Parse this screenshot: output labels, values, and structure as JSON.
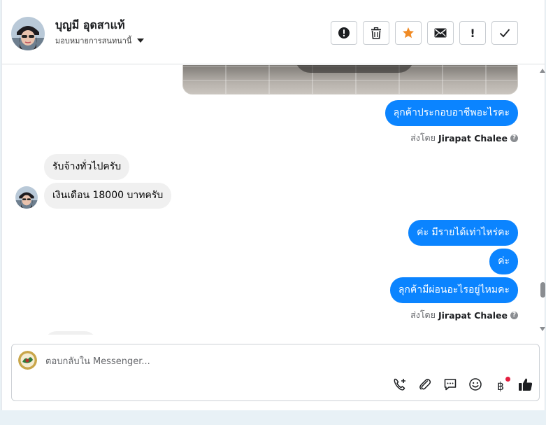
{
  "header": {
    "contact_name": "บุญมี อุดสาแท้",
    "assign_label": "มอบหมายการสนทนานี้"
  },
  "toolbar": {
    "buttons": [
      {
        "icon": "alert-circle-icon"
      },
      {
        "icon": "trash-icon"
      },
      {
        "icon": "star-icon",
        "color": "#f08a24"
      },
      {
        "icon": "envelope-icon"
      },
      {
        "icon": "exclamation-icon",
        "label": "!"
      },
      {
        "icon": "checkmark-icon"
      }
    ]
  },
  "messages": {
    "out1": "ลุกค้าประกอบอาชีพอะไรคะ",
    "sent_by_1": {
      "prefix": "ส่งโดย",
      "name": "Jirapat Chalee"
    },
    "in1": "รับจ้างทั่วไปครับ",
    "in2": "เงินเดือน 18000 บาทครับ",
    "out2": "ค่ะ มีรายได้เท่าไหร่คะ",
    "out3": "ค่ะ",
    "out4": "ลุกค้ามีผ่อนอะไรอยู่ไหมคะ",
    "sent_by_2": {
      "prefix": "ส่งโดย",
      "name": "Jirapat Chalee"
    }
  },
  "composer": {
    "placeholder": "ตอบกลับใน Messenger...",
    "actions": [
      "phone-add-icon",
      "paperclip-icon",
      "chat-bubble-icon",
      "emoji-icon",
      "baht-icon",
      "thumbs-up-icon"
    ],
    "baht_symbol": "฿"
  },
  "colors": {
    "outgoing_bubble": "#0b84ff",
    "incoming_bubble": "#f0f0f0",
    "star": "#f08a24",
    "notification_dot": "#e41e3f"
  }
}
